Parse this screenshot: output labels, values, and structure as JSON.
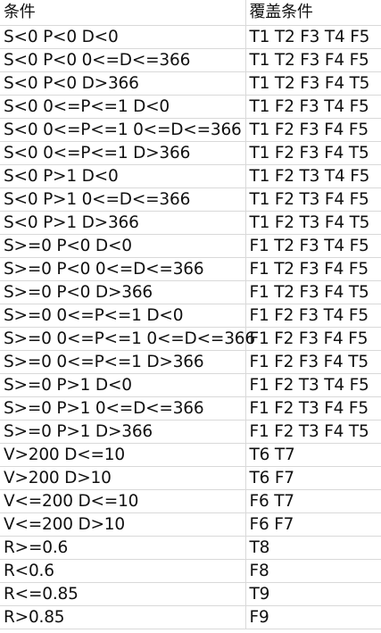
{
  "headers": [
    "条件",
    "覆盖条件"
  ],
  "rows": [
    [
      "S<0 P<0 D<0",
      "T1 T2 F3 T4 F5"
    ],
    [
      "S<0 P<0 0<=D<=366",
      "T1 T2 F3 F4 F5"
    ],
    [
      "S<0 P<0 D>366",
      "T1 T2 F3 F4 T5"
    ],
    [
      "S<0 0<=P<=1 D<0",
      "T1 F2 F3 T4 F5"
    ],
    [
      "S<0 0<=P<=1 0<=D<=366",
      "T1 F2 F3 F4 F5"
    ],
    [
      "S<0 0<=P<=1 D>366",
      "T1 F2 F3 F4 T5"
    ],
    [
      "S<0 P>1 D<0",
      "T1 F2 T3 T4 F5"
    ],
    [
      "S<0 P>1 0<=D<=366",
      "T1 F2 T3 F4 F5"
    ],
    [
      "S<0 P>1 D>366",
      "T1 F2 T3 F4 T5"
    ],
    [
      "S>=0 P<0 D<0",
      "F1 T2 F3 T4 F5"
    ],
    [
      "S>=0 P<0 0<=D<=366",
      "F1 T2 F3 F4 F5"
    ],
    [
      "S>=0 P<0 D>366",
      "F1 T2 F3 F4 T5"
    ],
    [
      "S>=0 0<=P<=1 D<0",
      "F1 F2 F3 T4 F5"
    ],
    [
      "S>=0 0<=P<=1 0<=D<=366",
      "F1 F2 F3 F4 F5"
    ],
    [
      "S>=0 0<=P<=1 D>366",
      "F1 F2 F3 F4 T5"
    ],
    [
      "S>=0 P>1 D<0",
      "F1 F2 T3 T4 F5"
    ],
    [
      "S>=0 P>1 0<=D<=366",
      "F1 F2 T3 F4 F5"
    ],
    [
      "S>=0 P>1 D>366",
      "F1 F2 T3 F4 T5"
    ],
    [
      "V>200 D<=10",
      "T6 T7"
    ],
    [
      "V>200 D>10",
      "T6 F7"
    ],
    [
      "V<=200 D<=10",
      "F6 T7"
    ],
    [
      "V<=200 D>10",
      "F6 F7"
    ],
    [
      "R>=0.6",
      "T8"
    ],
    [
      "R<0.6",
      "F8"
    ],
    [
      "R<=0.85",
      "T9"
    ],
    [
      "R>0.85",
      "F9"
    ]
  ]
}
